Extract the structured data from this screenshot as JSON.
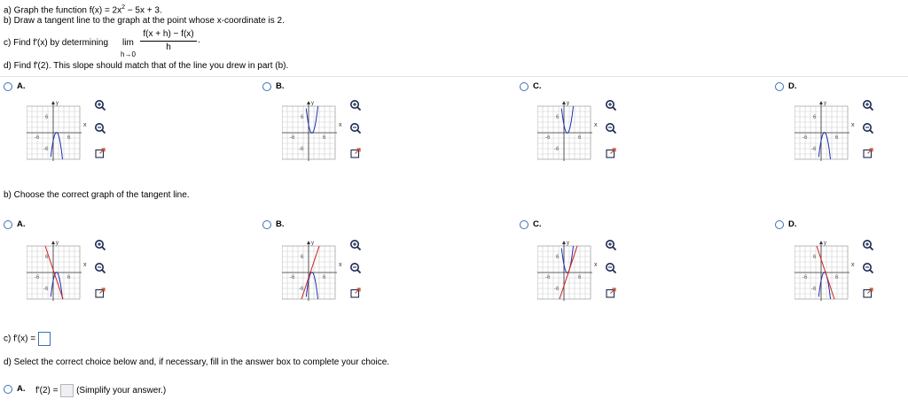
{
  "question": {
    "a_prefix": "a) Graph the function f(x) = 2x",
    "a_exp": "2",
    "a_suffix": " − 5x + 3.",
    "b": "b) Draw a tangent line to the graph at the point whose x-coordinate is 2.",
    "c_prefix": "c) Find f′(x) by determining",
    "c_lim": "lim",
    "c_lim_sub": "h→0",
    "c_num": "f(x + h) − f(x)",
    "c_den": "h",
    "c_period": ".",
    "d": "d) Find f′(2). This slope should match that of the line you drew in part (b)."
  },
  "part_a": {
    "choices": [
      {
        "letter": "A.",
        "shape": "down-parabola"
      },
      {
        "letter": "B.",
        "shape": "up-parabola"
      },
      {
        "letter": "C.",
        "shape": "up-parabola"
      },
      {
        "letter": "D.",
        "shape": "down-parabola"
      }
    ]
  },
  "part_b": {
    "label": "b) Choose the correct graph of the tangent line.",
    "choices": [
      {
        "letter": "A."
      },
      {
        "letter": "B."
      },
      {
        "letter": "C."
      },
      {
        "letter": "D."
      }
    ]
  },
  "graph_labels": {
    "y": "y",
    "x": "x",
    "top": "6",
    "bottom": "-6",
    "left": "-6",
    "right": "6"
  },
  "tools": {
    "zoom_in": "zoom-in",
    "zoom_out": "zoom-out",
    "popout": "popout"
  },
  "part_c": {
    "label": "c) f′(x) = "
  },
  "part_d": {
    "label": "d) Select the correct choice below and, if necessary, fill in the answer box to complete your choice.",
    "choice_letter": "A.",
    "choice_text": "f′(2) =",
    "hint": "(Simplify your answer.)"
  },
  "colors": {
    "radio": "#3d6fb6",
    "curve": "#1f2fb0",
    "tangent": "#d11f1f",
    "box": "#3d6fb6"
  }
}
